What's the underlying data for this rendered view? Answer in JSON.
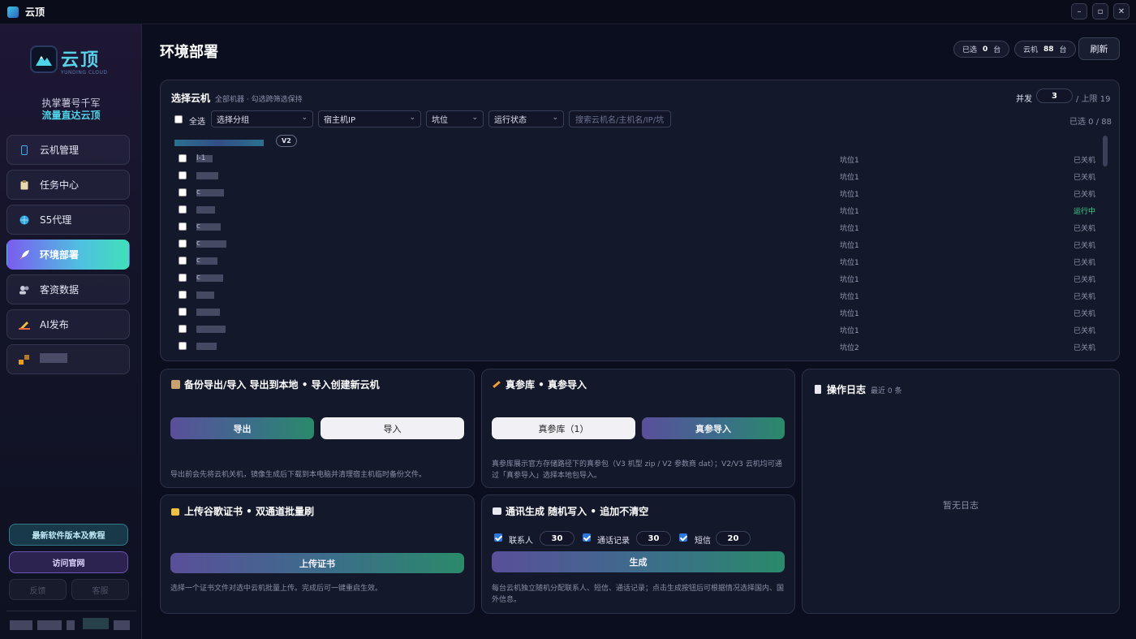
{
  "window": {
    "title": "云顶",
    "min": "–",
    "max": "▫",
    "close": "✕"
  },
  "brand": {
    "name": "云顶",
    "sub": "YUNDING CLOUD",
    "slogan1": "执掌薯号千军",
    "slogan2": "流量直达云顶"
  },
  "sidebar": {
    "items": [
      {
        "label": "云机管理",
        "icon": "phone-icon"
      },
      {
        "label": "任务中心",
        "icon": "clipboard-icon"
      },
      {
        "label": "S5代理",
        "icon": "globe-icon"
      },
      {
        "label": "环境部署",
        "icon": "rocket-icon"
      },
      {
        "label": "客资数据",
        "icon": "users-icon"
      },
      {
        "label": "AI发布",
        "icon": "pen-icon"
      }
    ],
    "btn_tutorial": "最新软件版本及教程",
    "btn_site": "访问官网",
    "btn_feedback": "反馈",
    "btn_support": "客服"
  },
  "header": {
    "title": "环境部署",
    "selected_label": "已选",
    "selected_count": "0",
    "selected_unit": "台",
    "cloud_label": "云机",
    "cloud_count": "88",
    "cloud_unit": "台",
    "refresh": "刷新"
  },
  "select_panel": {
    "title": "选择云机",
    "subtitle": "全部机器 · 勾选跨筛选保持",
    "concurrency_label": "并发",
    "concurrency_value": "3",
    "limit": "/ 上限 19",
    "select_all": "全选",
    "group_placeholder": "选择分组",
    "host_placeholder": "宿主机IP",
    "slot_placeholder": "坑位",
    "status_placeholder": "运行状态",
    "search_placeholder": "搜索云机名/主机名/IP/坑",
    "selected_text": "已选 0 / 88",
    "group_tag": "V2",
    "rows": [
      {
        "name": "l-1",
        "slot": "坑位1",
        "status": "已关机",
        "running": false
      },
      {
        "name": "",
        "slot": "坑位1",
        "status": "已关机",
        "running": false
      },
      {
        "name": "c",
        "slot": "坑位1",
        "status": "已关机",
        "running": false
      },
      {
        "name": "",
        "slot": "坑位1",
        "status": "运行中",
        "running": true
      },
      {
        "name": "c",
        "slot": "坑位1",
        "status": "已关机",
        "running": false
      },
      {
        "name": "c",
        "slot": "坑位1",
        "status": "已关机",
        "running": false
      },
      {
        "name": "c",
        "slot": "坑位1",
        "status": "已关机",
        "running": false
      },
      {
        "name": "c",
        "slot": "坑位1",
        "status": "已关机",
        "running": false
      },
      {
        "name": "",
        "slot": "坑位1",
        "status": "已关机",
        "running": false
      },
      {
        "name": "",
        "slot": "坑位1",
        "status": "已关机",
        "running": false
      },
      {
        "name": "",
        "slot": "坑位1",
        "status": "已关机",
        "running": false
      },
      {
        "name": "",
        "slot": "坑位2",
        "status": "已关机",
        "running": false
      }
    ]
  },
  "backup_panel": {
    "title": "备份导出/导入 导出到本地 • 导入创建新云机",
    "export": "导出",
    "import": "导入",
    "hint": "导出前会先将云机关机，镜像生成后下载到本电脑并清理宿主机临时备份文件。"
  },
  "real_panel": {
    "title": "真参库 • 真参导入",
    "library": "真参库（1）",
    "import": "真参导入",
    "hint": "真参库展示官方存储路径下的真参包（V3 机型 zip / V2 参数商 dat）；V2/V3 云机均可通过「真参导入」选择本地包导入。"
  },
  "log_panel": {
    "title": "操作日志",
    "recent": "最近 0 条",
    "empty": "暂无日志"
  },
  "cert_panel": {
    "title": "上传谷歌证书 • 双通道批量刷",
    "upload": "上传证书",
    "hint": "选择一个证书文件对选中云机批量上传。完成后可一键重启生效。"
  },
  "comm_panel": {
    "title": "通讯生成 随机写入 • 追加不清空",
    "contacts_label": "联系人",
    "contacts_value": "30",
    "calls_label": "通话记录",
    "calls_value": "30",
    "sms_label": "短信",
    "sms_value": "20",
    "generate": "生成",
    "hint": "每台云机独立随机分配联系人、短信、通话记录；点击生成按钮后可根据情况选择国内、国外信息。"
  }
}
